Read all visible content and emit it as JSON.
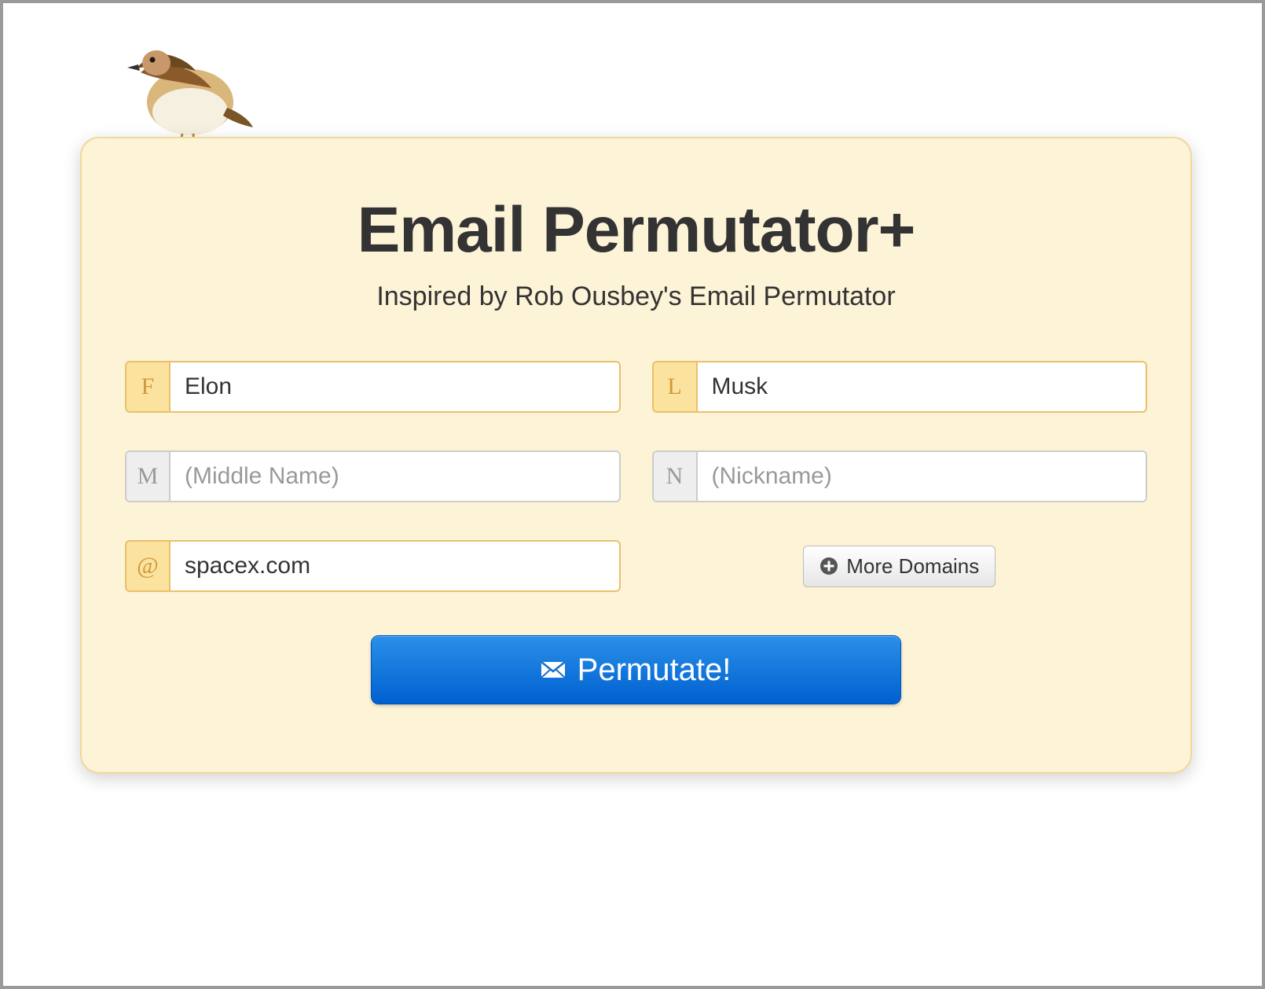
{
  "header": {
    "title": "Email Permutator+",
    "subtitle": "Inspired by Rob Ousbey's Email Permutator"
  },
  "fields": {
    "first": {
      "prefix": "F",
      "value": "Elon",
      "placeholder": ""
    },
    "last": {
      "prefix": "L",
      "value": "Musk",
      "placeholder": ""
    },
    "middle": {
      "prefix": "M",
      "value": "",
      "placeholder": "(Middle Name)"
    },
    "nickname": {
      "prefix": "N",
      "value": "",
      "placeholder": "(Nickname)"
    },
    "domain": {
      "prefix": "@",
      "value": "spacex.com",
      "placeholder": ""
    }
  },
  "buttons": {
    "more_domains": "More Domains",
    "permutate": "Permutate!"
  }
}
